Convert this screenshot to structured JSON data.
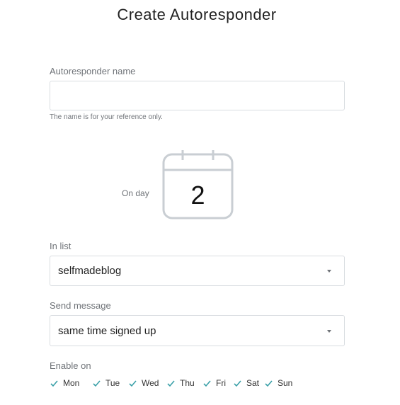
{
  "page": {
    "title": "Create Autoresponder"
  },
  "name_field": {
    "label": "Autoresponder name",
    "value": "",
    "placeholder": "",
    "hint": "The name is for your reference only."
  },
  "schedule": {
    "on_day_label": "On day",
    "day": "2",
    "icon": "calendar-icon"
  },
  "list_field": {
    "label": "In list",
    "selected": "selfmadeblog"
  },
  "send_field": {
    "label": "Send message",
    "selected": "same time signed up"
  },
  "enable_on": {
    "label": "Enable on",
    "days": [
      {
        "label": "Mon",
        "checked": true
      },
      {
        "label": "Tue",
        "checked": true
      },
      {
        "label": "Wed",
        "checked": true
      },
      {
        "label": "Thu",
        "checked": true
      },
      {
        "label": "Fri",
        "checked": true
      },
      {
        "label": "Sat",
        "checked": true
      },
      {
        "label": "Sun",
        "checked": true
      }
    ]
  },
  "colors": {
    "check": "#3aa0a8",
    "calendar_stroke": "#c9ced3",
    "border": "#d9dde1",
    "label": "#6f7378"
  }
}
